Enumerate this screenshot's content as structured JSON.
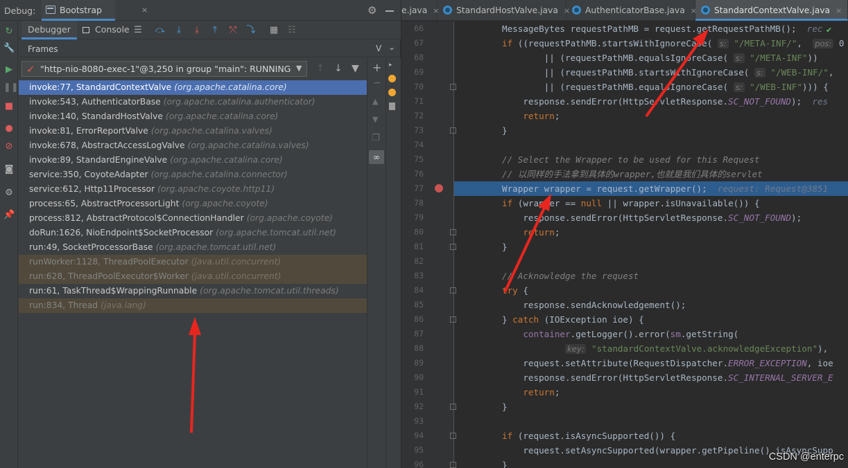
{
  "debug": {
    "label": "Debug:",
    "session_tab": "Bootstrap",
    "close": "×",
    "subtabs": {
      "debugger": "Debugger",
      "console": "Console"
    },
    "frames_label": "Frames",
    "frames_vlabel": "V",
    "thread": "\"http-nio-8080-exec-1\"@3,250 in group \"main\": RUNNING",
    "frames": [
      {
        "method": "invoke:77, StandardContextValve",
        "pkg": "(org.apache.catalina.core)",
        "state": "selected"
      },
      {
        "method": "invoke:543, AuthenticatorBase",
        "pkg": "(org.apache.catalina.authenticator)",
        "state": "normal"
      },
      {
        "method": "invoke:140, StandardHostValve",
        "pkg": "(org.apache.catalina.core)",
        "state": "normal"
      },
      {
        "method": "invoke:81, ErrorReportValve",
        "pkg": "(org.apache.catalina.valves)",
        "state": "normal"
      },
      {
        "method": "invoke:678, AbstractAccessLogValve",
        "pkg": "(org.apache.catalina.valves)",
        "state": "normal"
      },
      {
        "method": "invoke:89, StandardEngineValve",
        "pkg": "(org.apache.catalina.core)",
        "state": "normal"
      },
      {
        "method": "service:350, CoyoteAdapter",
        "pkg": "(org.apache.catalina.connector)",
        "state": "normal"
      },
      {
        "method": "service:612, Http11Processor",
        "pkg": "(org.apache.coyote.http11)",
        "state": "normal"
      },
      {
        "method": "process:65, AbstractProcessorLight",
        "pkg": "(org.apache.coyote)",
        "state": "normal"
      },
      {
        "method": "process:812, AbstractProtocol$ConnectionHandler",
        "pkg": "(org.apache.coyote)",
        "state": "normal"
      },
      {
        "method": "doRun:1626, NioEndpoint$SocketProcessor",
        "pkg": "(org.apache.tomcat.util.net)",
        "state": "normal"
      },
      {
        "method": "run:49, SocketProcessorBase",
        "pkg": "(org.apache.tomcat.util.net)",
        "state": "normal"
      },
      {
        "method": "runWorker:1128, ThreadPoolExecutor",
        "pkg": "(java.util.concurrent)",
        "state": "lib"
      },
      {
        "method": "run:628, ThreadPoolExecutor$Worker",
        "pkg": "(java.util.concurrent)",
        "state": "lib"
      },
      {
        "method": "run:61, TaskThread$WrappingRunnable",
        "pkg": "(org.apache.tomcat.util.threads)",
        "state": "normal"
      },
      {
        "method": "run:834, Thread",
        "pkg": "(java.lang)",
        "state": "lib"
      }
    ]
  },
  "editor": {
    "tabs": [
      {
        "label": "e.java",
        "active": false,
        "close": "×"
      },
      {
        "label": "StandardHostValve.java",
        "active": false,
        "close": "×"
      },
      {
        "label": "AuthenticatorBase.java",
        "active": false,
        "close": "×"
      },
      {
        "label": "StandardContextValve.java",
        "active": true,
        "close": "×"
      }
    ],
    "first_line": 66,
    "highlight_line": 77,
    "breakpoint_line": 77,
    "lines": [
      {
        "n": "66",
        "html": "MessageBytes requestPathMB = request.getRequestPathMB();  <span class=\"inline-val\">rec</span>"
      },
      {
        "n": "67",
        "html": "<span class=\"kw\">if</span> ((requestPathMB.startsWithIgnoreCase( <span class=\"hint\">s:</span> <span class=\"str\">\"/META-INF/\"</span>,  <span class=\"hint\">pos:</span> 0"
      },
      {
        "n": "68",
        "html": "        || (requestPathMB.equalsIgnoreCase( <span class=\"hint\">s:</span> <span class=\"str\">\"/META-INF\"</span>))"
      },
      {
        "n": "69",
        "html": "        || (requestPathMB.startsWithIgnoreCase( <span class=\"hint\">s:</span> <span class=\"str\">\"/WEB-INF/\"</span>,"
      },
      {
        "n": "70",
        "html": "        || (requestPathMB.equalsIgnoreCase( <span class=\"hint\">s:</span> <span class=\"str\">\"/WEB-INF\"</span>))) {"
      },
      {
        "n": "71",
        "html": "    response.sendError(HttpServletResponse.<span class=\"cn\">SC_NOT_FOUND</span>);  <span class=\"inline-val\">res</span>"
      },
      {
        "n": "72",
        "html": "    <span class=\"kw\">return</span>;"
      },
      {
        "n": "73",
        "html": "}"
      },
      {
        "n": "74",
        "html": ""
      },
      {
        "n": "75",
        "html": "<span class=\"cm\">// Select the Wrapper to be used for this Request</span>"
      },
      {
        "n": "76",
        "html": "<span class=\"cm\">// 以同样的手法拿到具体的wrapper,也就是我们具体的servlet</span>"
      },
      {
        "n": "77",
        "html": "Wrapper wrapper = request.getWrapper();  <span class=\"inline-val\">request: Request@3851</span>"
      },
      {
        "n": "78",
        "html": "<span class=\"kw\">if</span> (wrapper == <span class=\"kw\">null</span> || wrapper.isUnavailable()) {"
      },
      {
        "n": "79",
        "html": "    response.sendError(HttpServletResponse.<span class=\"cn\">SC_NOT_FOUND</span>);"
      },
      {
        "n": "80",
        "html": "    <span class=\"kw\">return</span>;"
      },
      {
        "n": "81",
        "html": "}"
      },
      {
        "n": "82",
        "html": ""
      },
      {
        "n": "83",
        "html": "<span class=\"cm\">// Acknowledge the request</span>"
      },
      {
        "n": "84",
        "html": "<span class=\"kw\">try</span> {"
      },
      {
        "n": "85",
        "html": "    response.sendAcknowledgement();"
      },
      {
        "n": "86",
        "html": "} <span class=\"kw\">catch</span> (IOException ioe) {"
      },
      {
        "n": "87",
        "html": "    <span class=\"fld\">container</span>.getLogger().error(<span class=\"fld\">sm</span>.getString("
      },
      {
        "n": "88",
        "html": "            <span class=\"hint\">key:</span> <span class=\"str\">\"standardContextValve.acknowledgeException\"</span>),"
      },
      {
        "n": "89",
        "html": "    request.setAttribute(RequestDispatcher.<span class=\"cn\">ERROR_EXCEPTION</span>, ioe"
      },
      {
        "n": "90",
        "html": "    response.sendError(HttpServletResponse.<span class=\"cn\">SC_INTERNAL_SERVER_E</span>"
      },
      {
        "n": "91",
        "html": "    <span class=\"kw\">return</span>;"
      },
      {
        "n": "92",
        "html": "}"
      },
      {
        "n": "93",
        "html": ""
      },
      {
        "n": "94",
        "html": "<span class=\"kw\">if</span> (request.isAsyncSupported()) {"
      },
      {
        "n": "95",
        "html": "    request.setAsyncSupported(wrapper.getPipeline().isAsyncSupp"
      },
      {
        "n": "96",
        "html": "}"
      }
    ]
  },
  "watermark": "CSDN @enterpc",
  "colors": {
    "accent": "#4a88c7",
    "selection": "#4b6eaf",
    "annotation": "#e8261f"
  }
}
